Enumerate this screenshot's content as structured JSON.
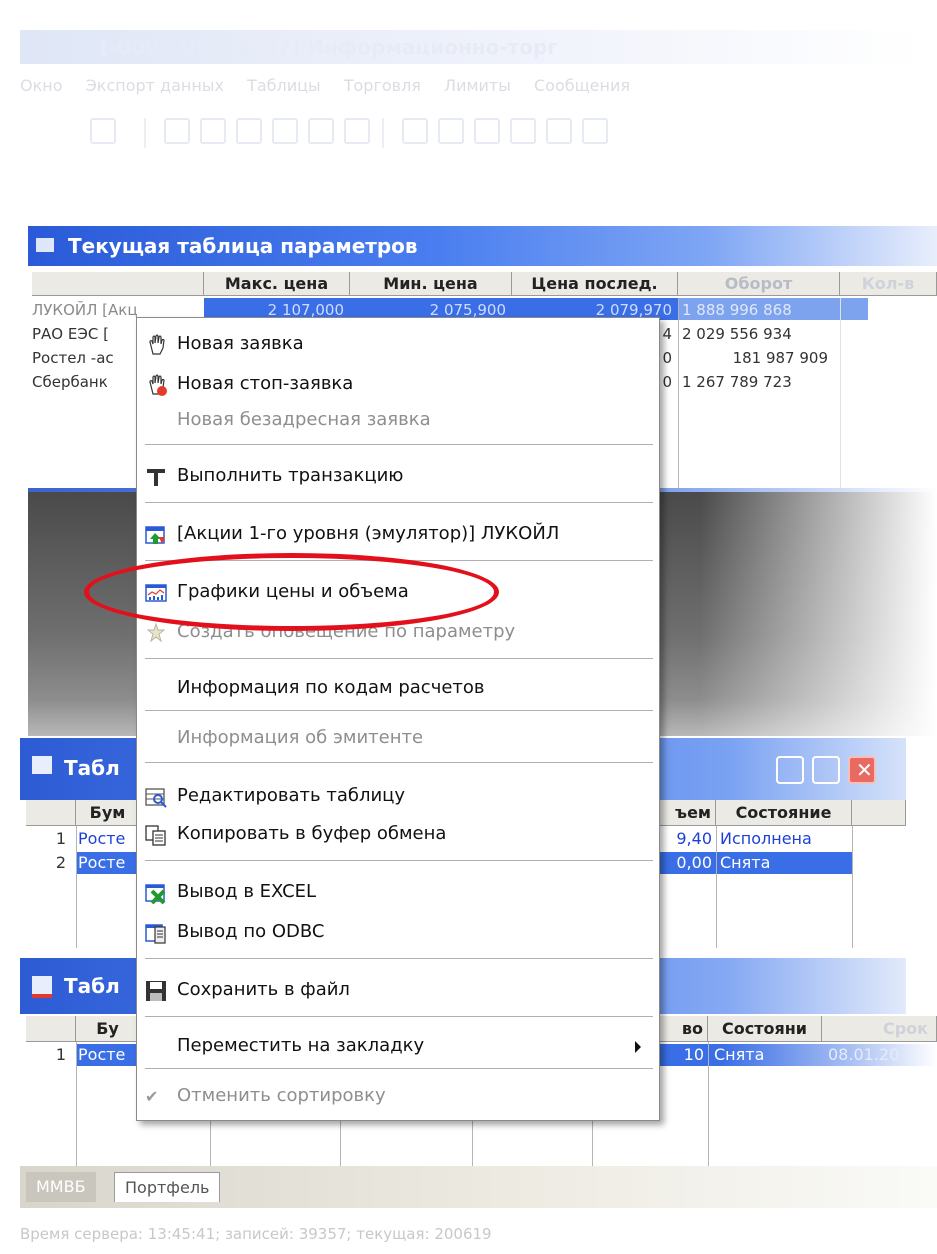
{
  "app": {
    "title": "[-0007 UID: 1537] Информационно-торг",
    "menu": [
      "Окно",
      "Экспорт данных",
      "Таблицы",
      "Торговля",
      "Лимиты",
      "Сообщения"
    ]
  },
  "params_window": {
    "title": "Текущая таблица параметров",
    "columns": [
      "Макс. цена",
      "Мин. цена",
      "Цена послед.",
      "Оборот",
      "Кол-в"
    ],
    "rows": [
      {
        "name": "ЛУКОЙЛ [Акц",
        "max": "2 107,000",
        "min": "2 075,900",
        "last": "2 079,970",
        "turnover": "1 888 996 868"
      },
      {
        "name": "РАО ЕЭС [",
        "last_tail": "4",
        "turnover": "2 029 556 934"
      },
      {
        "name": "Ростел -ас",
        "last_tail": "0",
        "turnover": "181 987 909"
      },
      {
        "name": "Сбербанк",
        "last_tail": "0",
        "turnover": "1 267 789 723"
      }
    ]
  },
  "orders_window": {
    "title": "Табл",
    "columns": [
      "Бум",
      "ъем",
      "Состояние"
    ],
    "rows": [
      {
        "num": "1",
        "name": "Росте",
        "volume": "9,40",
        "state": "Исполнена"
      },
      {
        "num": "2",
        "name": "Росте",
        "volume": "0,00",
        "state": "Снята"
      }
    ]
  },
  "stop_orders_window": {
    "title": "Табл",
    "columns": [
      "Бу",
      "во",
      "Состояни",
      "Срок"
    ],
    "rows": [
      {
        "num": "1",
        "name": "Росте",
        "qty": "10",
        "state": "Снята",
        "date": "08.01.20"
      }
    ]
  },
  "tabs": [
    "ММВБ",
    "Портфель"
  ],
  "status": "Время сервера: 13:45:41; записей: 39357; текущая: 200619",
  "context_menu": {
    "items": [
      {
        "label": "Новая заявка",
        "icon": "hand-icon",
        "disabled": false
      },
      {
        "label": "Новая стоп-заявка",
        "icon": "hand-stop-icon",
        "disabled": false
      },
      {
        "label": "Новая безадресная заявка",
        "icon": "",
        "disabled": true
      },
      {
        "label": "Выполнить транзакцию",
        "icon": "transaction-t-icon",
        "disabled": false
      },
      {
        "label": "[Акции 1-го уровня (эмулятор)] ЛУКОЙЛ",
        "icon": "quotes-icon",
        "disabled": false
      },
      {
        "label": "Графики цены и объема",
        "icon": "chart-icon",
        "disabled": false
      },
      {
        "label": "Создать оповещение по параметру",
        "icon": "alert-icon",
        "disabled": true
      },
      {
        "label": "Информация по кодам расчетов",
        "icon": "",
        "disabled": false
      },
      {
        "label": "Информация об эмитенте",
        "icon": "",
        "disabled": true
      },
      {
        "label": "Редактировать таблицу",
        "icon": "edit-table-icon",
        "disabled": false
      },
      {
        "label": "Копировать в буфер обмена",
        "icon": "copy-icon",
        "disabled": false
      },
      {
        "label": "Вывод в EXCEL",
        "icon": "excel-icon",
        "disabled": false
      },
      {
        "label": "Вывод по ODBC",
        "icon": "odbc-icon",
        "disabled": false
      },
      {
        "label": "Сохранить в файл",
        "icon": "save-icon",
        "disabled": false
      },
      {
        "label": "Переместить на закладку",
        "icon": "",
        "disabled": false
      },
      {
        "label": "Отменить сортировку",
        "icon": "check-icon",
        "disabled": true
      }
    ]
  },
  "colors": {
    "title_blue": "#2a5ad8",
    "highlight_ellipse": "#e3101c",
    "selected_row": "#3a6ee6"
  }
}
